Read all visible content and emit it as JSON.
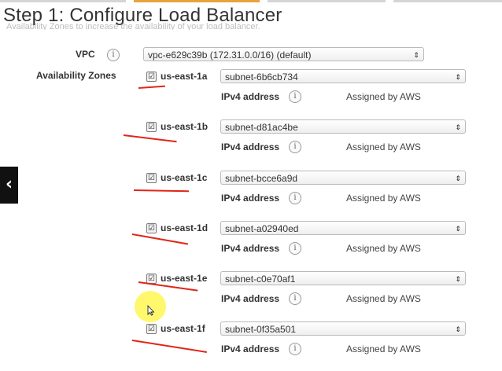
{
  "header": {
    "title": "Step 1: Configure Load Balancer",
    "subtitle": "Availability Zones to increase the availability of your load balancer."
  },
  "vpc": {
    "label": "VPC",
    "value": "vpc-e629c39b (172.31.0.0/16) (default)"
  },
  "availability_zones_label": "Availability Zones",
  "ipv4_label": "IPv4 address",
  "assigned_text": "Assigned by AWS",
  "info_glyph": "i",
  "zones": [
    {
      "name": "us-east-1a",
      "subnet": "subnet-6b6cb734",
      "checked": true
    },
    {
      "name": "us-east-1b",
      "subnet": "subnet-d81ac4be",
      "checked": true
    },
    {
      "name": "us-east-1c",
      "subnet": "subnet-bcce6a9d",
      "checked": true
    },
    {
      "name": "us-east-1d",
      "subnet": "subnet-a02940ed",
      "checked": true
    },
    {
      "name": "us-east-1e",
      "subnet": "subnet-c0e70af1",
      "checked": true
    },
    {
      "name": "us-east-1f",
      "subnet": "subnet-0f35a501",
      "checked": true
    }
  ],
  "icons": {
    "checkbox": "☑",
    "dropdown": "⇕",
    "nav_left": "‹"
  },
  "colors": {
    "annotation_red": "#e02618",
    "highlight_yellow": "#fff53c",
    "active_tab": "#e8a33d"
  }
}
